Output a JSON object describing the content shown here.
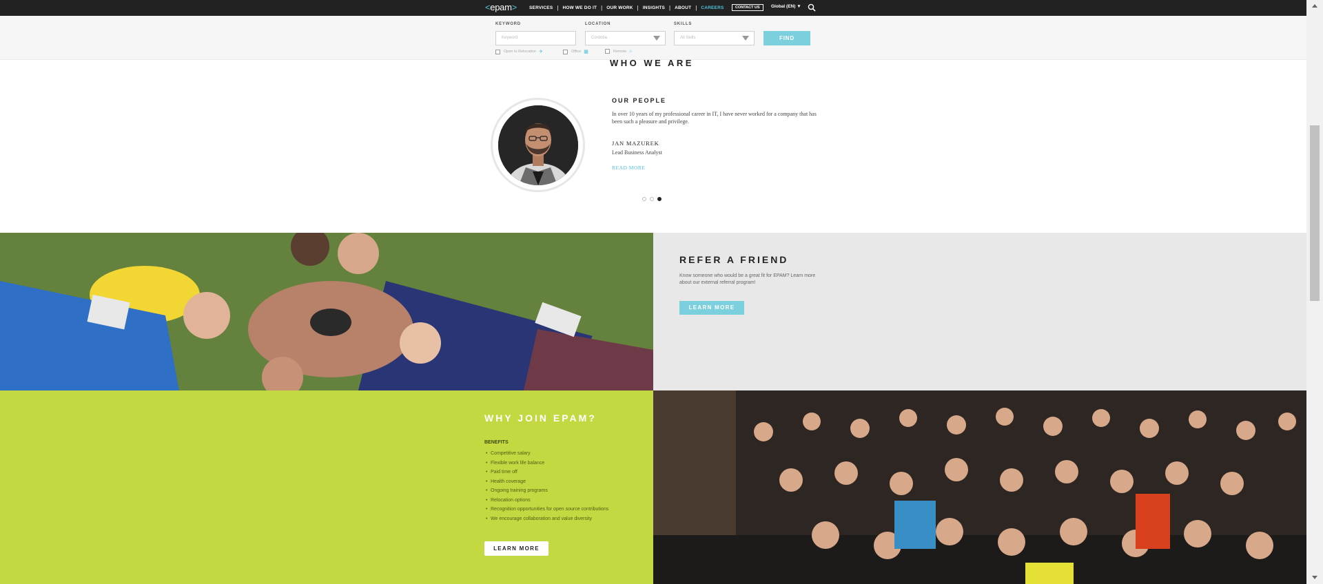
{
  "nav": {
    "logo": "epam",
    "links": [
      "SERVICES",
      "HOW WE DO IT",
      "OUR WORK",
      "INSIGHTS",
      "ABOUT",
      "CAREERS"
    ],
    "active_link": "CAREERS",
    "contact": "CONTACT US",
    "region": "Global (EN)",
    "accent_color": "#4fc3dc"
  },
  "search": {
    "keyword_label": "KEYWORD",
    "keyword_placeholder": "Keyword",
    "location_label": "LOCATION",
    "location_value": "Cordoba",
    "skills_label": "SKILLS",
    "skills_value": "All Skills",
    "find": "FIND",
    "options": [
      {
        "label": "Open to Relocation",
        "icon": "airplane-icon"
      },
      {
        "label": "Office",
        "icon": "office-building-icon"
      },
      {
        "label": "Remote",
        "icon": "home-icon"
      }
    ]
  },
  "who_we_are": {
    "title": "WHO WE ARE",
    "section": "OUR PEOPLE",
    "quote": "In over 10 years of my professional career in IT, I have never worked for a company that has been such a pleasure and privilege.",
    "name": "JAN MAZUREK",
    "role": "Lead Business Analyst",
    "read_more": "READ MORE",
    "carousel_active_index": 2,
    "carousel_count": 3
  },
  "refer": {
    "title": "REFER A FRIEND",
    "text": "Know someone who would be a great fit for EPAM? Learn more about our external referral program!",
    "button": "LEARN MORE",
    "background": "#e8e8e8",
    "button_color": "#7ccfdc"
  },
  "why_join": {
    "title": "WHY JOIN EPAM?",
    "benefits_label": "BENEFITS",
    "benefits": [
      "Competitive salary",
      "Flexible work life balance",
      "Paid time off",
      "Health coverage",
      "Ongoing training programs",
      "Relocation options",
      "Recognition opportunities for open source contributions",
      "We encourage collaboration and value diversity"
    ],
    "button": "LEARN MORE",
    "background": "#c4d941"
  }
}
